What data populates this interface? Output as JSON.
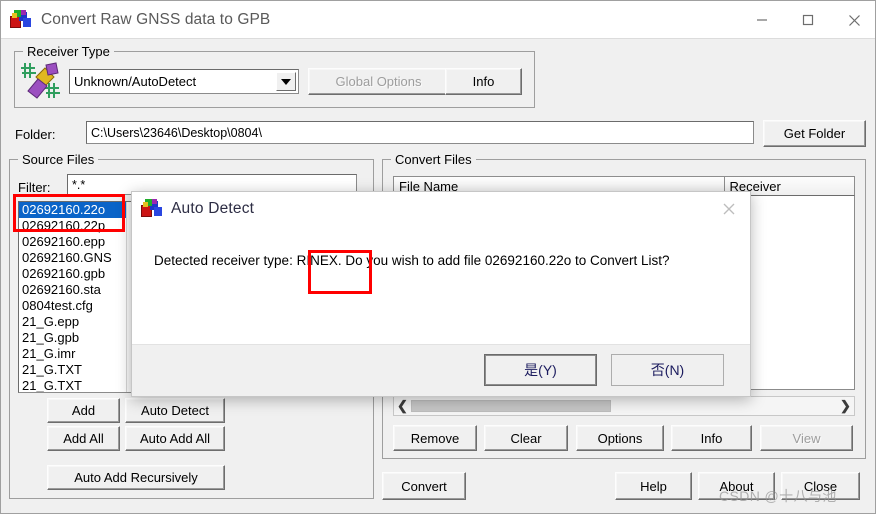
{
  "window": {
    "title": "Convert Raw GNSS data to GPB",
    "icon": "gnss-app-icon",
    "controls": {
      "minimize": "minimize-icon",
      "maximize": "maximize-icon",
      "close": "close-icon"
    }
  },
  "receiver_type": {
    "legend": "Receiver Type",
    "icon": "satellite-icon",
    "combo_value": "Unknown/AutoDetect",
    "global_options_label": "Global Options",
    "global_options_disabled": true,
    "info_label": "Info"
  },
  "folder": {
    "label": "Folder:",
    "value": "C:\\Users\\23646\\Desktop\\0804\\",
    "get_folder_label": "Get Folder"
  },
  "source_files": {
    "legend": "Source Files",
    "filter_label": "Filter:",
    "filter_value": "*.*",
    "files": [
      "02692160.22o",
      "02692160.22p",
      "02692160.epp",
      "02692160.GNS",
      "02692160.gpb",
      "02692160.sta",
      "0804test.cfg",
      "21_G.epp",
      "21_G.gpb",
      "21_G.imr",
      "21_G.TXT",
      "21_G.TXT"
    ],
    "selected_index": 0,
    "buttons": {
      "add": "Add",
      "auto_detect": "Auto Detect",
      "add_all": "Add All",
      "auto_add_all": "Auto Add All",
      "auto_add_recursively": "Auto Add Recursively"
    }
  },
  "convert_files": {
    "legend": "Convert Files",
    "columns": [
      "File Name",
      "Receiver"
    ],
    "rows": [],
    "scrollbar": {
      "left_arrow": "chevron-left-icon",
      "right_arrow": "chevron-right-icon"
    },
    "buttons": {
      "remove": "Remove",
      "clear": "Clear",
      "options": "Options",
      "info": "Info",
      "view": "View",
      "view_disabled": true
    }
  },
  "footer": {
    "convert": "Convert",
    "help": "Help",
    "about": "About",
    "close": "Close"
  },
  "dialog": {
    "title": "Auto Detect",
    "icon": "gnss-app-icon",
    "close_icon": "close-icon",
    "message": "Detected receiver type: RINEX. Do you wish to add file 02692160.22o to Convert List?",
    "yes_label": "是(Y)",
    "no_label": "否(N)"
  },
  "annotations": {
    "color": "#ff0000",
    "boxes": [
      "selected-file-highlight",
      "detected-type-rinex"
    ]
  },
  "watermark": "CSDN @十八与池"
}
